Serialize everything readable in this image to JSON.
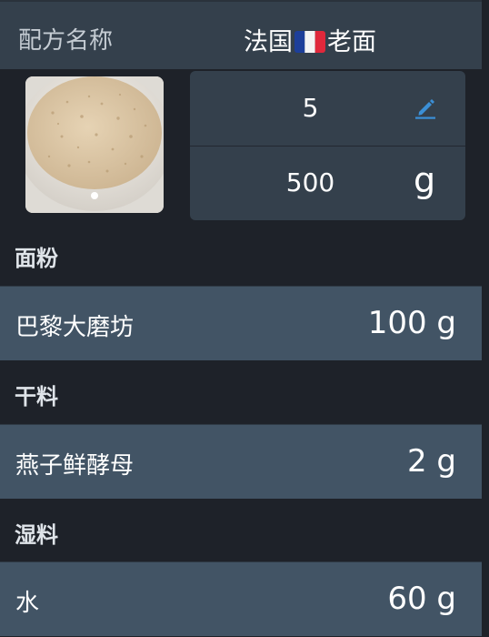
{
  "header": {
    "label": "配方名称",
    "title_prefix": "法国",
    "title_suffix": "老面"
  },
  "recipe": {
    "quantity": "5",
    "weight": "500",
    "weight_unit": "g"
  },
  "sections": [
    {
      "title": "面粉",
      "items": [
        {
          "name": "巴黎大磨坊",
          "amount": "100 g"
        }
      ]
    },
    {
      "title": "干料",
      "items": [
        {
          "name": "燕子鲜酵母",
          "amount": "2 g"
        }
      ]
    },
    {
      "title": "湿料",
      "items": [
        {
          "name": "水",
          "amount": "60 g"
        }
      ]
    }
  ],
  "colors": {
    "background": "#1e2229",
    "header": "#34404c",
    "item_row": "#425465",
    "edit_icon": "#3b8fd6"
  }
}
